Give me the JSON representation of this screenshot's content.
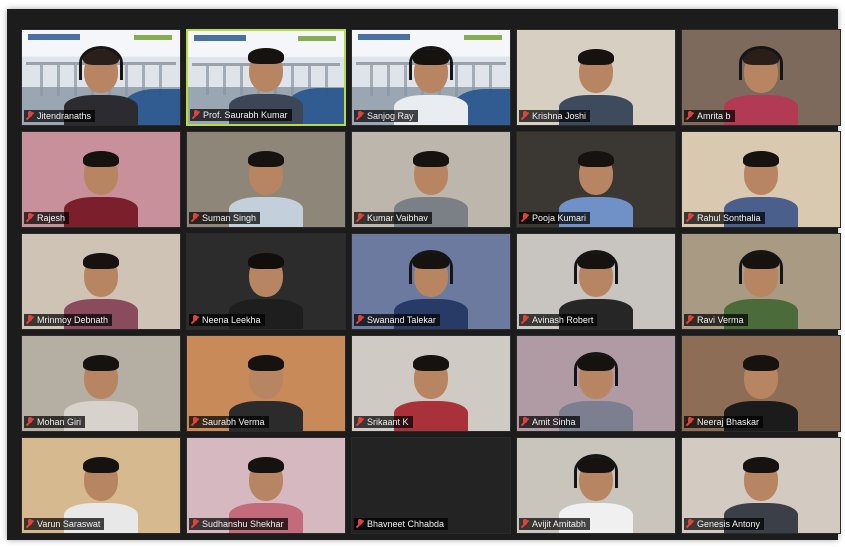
{
  "participants": [
    {
      "name": "Jitendranaths",
      "bg": "banner",
      "shirt": "#2b2b30",
      "headset": true,
      "hair": "#2a1f1a"
    },
    {
      "name": "Prof. Saurabh Kumar",
      "bg": "banner",
      "shirt": "#3d4656",
      "active": true,
      "hair": "#161210"
    },
    {
      "name": "Sanjog Ray",
      "bg": "banner",
      "shirt": "#e9edf2",
      "headset": true,
      "hair": "#161210"
    },
    {
      "name": "Krishna Joshi",
      "bg": "#d7cfc2",
      "shirt": "#3d4b5c",
      "hair": "#161210"
    },
    {
      "name": "Amrita b",
      "bg": "#7d6a5c",
      "shirt": "#b23a55",
      "headset": true,
      "hair": "#2b1d18"
    },
    {
      "name": "Rajesh",
      "bg": "#c7909a",
      "shirt": "#7a1f2b",
      "hair": "#161210"
    },
    {
      "name": "Suman Singh",
      "bg": "#8e8679",
      "shirt": "#c4cfdc",
      "hair": "#161210"
    },
    {
      "name": "Kumar Vaibhav",
      "bg": "#bdb6ad",
      "shirt": "#7b7f86",
      "hair": "#161210"
    },
    {
      "name": "Pooja Kumari",
      "bg": "#3b3733",
      "shirt": "#6f91c7",
      "hair": "#161210"
    },
    {
      "name": "Rahul Sonthalia",
      "bg": "#d8c9b0",
      "shirt": "#4a5f8c",
      "hair": "#161210"
    },
    {
      "name": "Mrinmoy Debnath",
      "bg": "#cfc3b6",
      "shirt": "#8a4b5f",
      "hair": "#161210"
    },
    {
      "name": "Neena Leekha",
      "bg": "#2c2c2c",
      "shirt": "#1e1e1e",
      "hair": "#120e0c"
    },
    {
      "name": "Swanand Talekar",
      "bg": "#6b7a9e",
      "shirt": "#283a66",
      "headset": true,
      "hair": "#161210"
    },
    {
      "name": "Avinash Robert",
      "bg": "#c8c5c0",
      "shirt": "#262626",
      "headset": true,
      "hair": "#161210"
    },
    {
      "name": "Ravi Verma",
      "bg": "#a89a83",
      "shirt": "#4b6b3b",
      "headset": true,
      "hair": "#161210"
    },
    {
      "name": "Mohan Giri",
      "bg": "#b4aea3",
      "shirt": "#d7d2cc",
      "hair": "#161210"
    },
    {
      "name": "Saurabh Verma",
      "bg": "#c98a59",
      "shirt": "#2b2b2b",
      "hair": "#161210"
    },
    {
      "name": "Srikaant K",
      "bg": "#cfcac3",
      "shirt": "#a8313a",
      "hair": "#161210"
    },
    {
      "name": "Amit Sinha",
      "bg": "#b09aa3",
      "shirt": "#7c7f8f",
      "headset": true,
      "hair": "#161210"
    },
    {
      "name": "Neeraj Bhaskar",
      "bg": "#8d6d55",
      "shirt": "#1b1b1b",
      "hair": "#161210"
    },
    {
      "name": "Varun Saraswat",
      "bg": "#d7b98f",
      "shirt": "#e8e8e8",
      "hair": "#161210"
    },
    {
      "name": "Sudhanshu Shekhar",
      "bg": "#d6b8c1",
      "shirt": "#c36a7b",
      "hair": "#161210"
    },
    {
      "name": "Bhavneet Chhabda",
      "bg": "blank",
      "shirt": "",
      "hair": ""
    },
    {
      "name": "Avijit Amitabh",
      "bg": "#c9c4bc",
      "shirt": "#f0f0f0",
      "headset": true,
      "hair": "#161210"
    },
    {
      "name": "Genesis Antony",
      "bg": "#d3cbc1",
      "shirt": "#3b3f47",
      "hair": "#161210"
    }
  ]
}
